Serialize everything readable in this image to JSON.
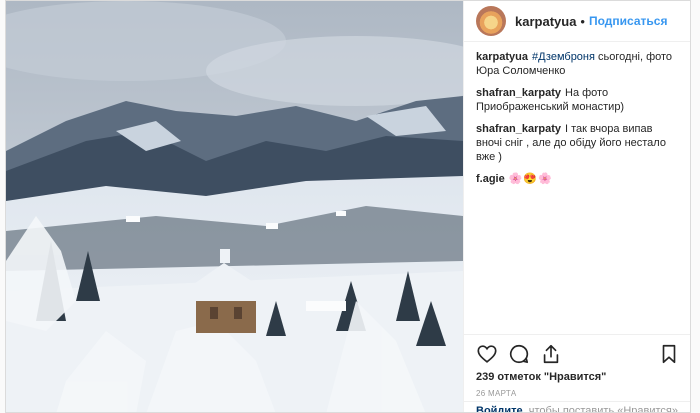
{
  "header": {
    "username": "karpatyua",
    "separator": "•",
    "follow_label": "Подписаться"
  },
  "comments": [
    {
      "user": "karpatyua",
      "hashtag": "#Дземброня",
      "text": " сьогодні, фото Юра Соломченко"
    },
    {
      "user": "shafran_karpaty",
      "text": "На фото Приображенський монастир)"
    },
    {
      "user": "shafran_karpaty",
      "text": "I так вчора випав вночі сніг , але до обіду його нестало вже )"
    },
    {
      "user": "f.agie",
      "emoji": "🌸😍🌸"
    }
  ],
  "actions": {
    "like_icon": "heart-icon",
    "comment_icon": "comment-icon",
    "share_icon": "share-icon",
    "save_icon": "bookmark-icon"
  },
  "likes_text": "239 отметок \"Нравится\"",
  "date": "26 МАРТА",
  "login": {
    "link": "Войдите,",
    "text": " чтобы поставить «Нравится»"
  }
}
